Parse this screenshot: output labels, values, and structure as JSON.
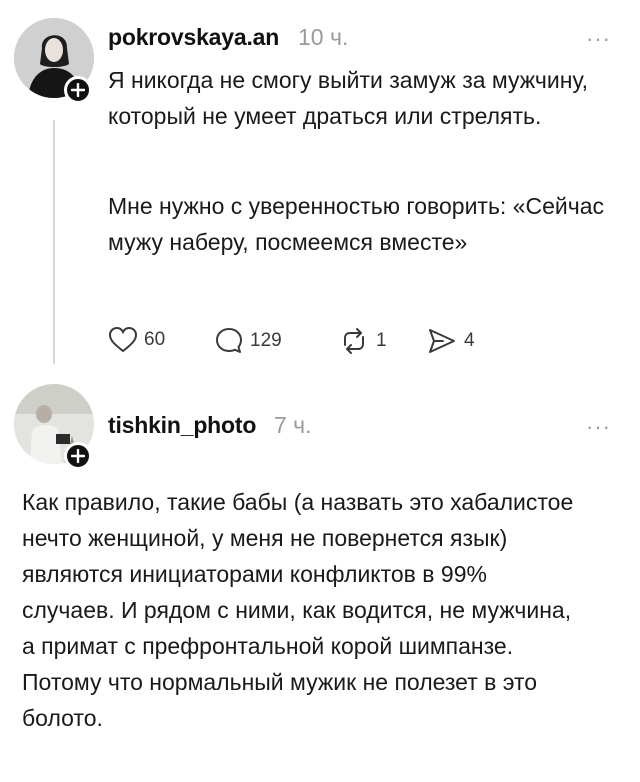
{
  "post": {
    "username": "pokrovskaya.an",
    "time": "10 ч.",
    "more": "···",
    "paragraph1": "Я никогда не смогу выйти замуж за мужчину, который не умеет драться или стрелять.",
    "paragraph2": "Мне нужно с уверенностью говорить: «Сейчас мужу наберу, посмеемся вместе»",
    "actions": {
      "likes": "60",
      "comments": "129",
      "reposts": "1",
      "shares": "4"
    }
  },
  "reply": {
    "username": "tishkin_photo",
    "time": "7 ч.",
    "more": "···",
    "text": "Как правило, такие бабы (а назвать это хабалистое нечто женщиной, у меня не повернется язык) являются инициаторами конфликтов в 99% случаев. И рядом с ними, как водится, не мужчина, а примат с префронтальной корой шимпанзе. Потому что нормальный мужик не полезет в это болото."
  },
  "icons": {
    "like": "heart-icon",
    "comment": "speech-bubble-icon",
    "repost": "repost-arrows-icon",
    "share": "send-icon",
    "follow": "plus-icon",
    "menu": "more-dots-icon"
  }
}
